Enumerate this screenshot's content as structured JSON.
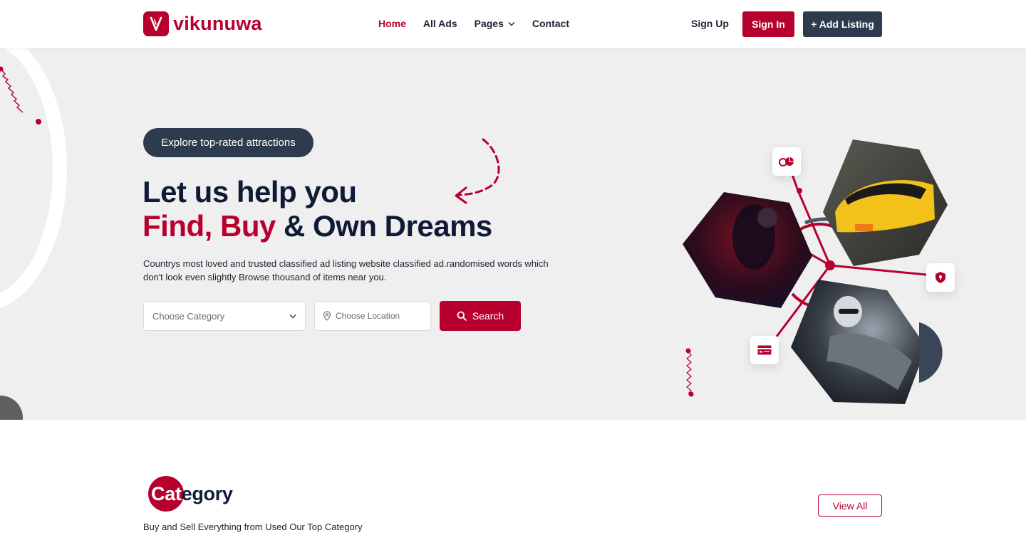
{
  "brand": {
    "name": "vikunuwa",
    "accent": "#b8002e",
    "dark": "#2e3b4e",
    "hero_bg": "#efefef"
  },
  "nav": {
    "items": [
      {
        "label": "Home",
        "active": true
      },
      {
        "label": "All Ads"
      },
      {
        "label": "Pages",
        "has_dropdown": true
      },
      {
        "label": "Contact"
      }
    ]
  },
  "auth": {
    "signup": "Sign Up",
    "signin": "Sign In",
    "add_listing": "+ Add Listing"
  },
  "hero": {
    "pill": "Explore top-rated attractions",
    "headline_1": "Let us help you",
    "headline_2a": "Find,",
    "headline_2b": "Buy",
    "headline_2c": "& Own Dreams",
    "description": "Countrys most loved and trusted classified ad listing website classified ad.randomised words which don't look even slightly Browse thousand of items near you.",
    "category_placeholder": "Choose Category",
    "location_placeholder": "Choose Location",
    "search_label": "Search"
  },
  "category": {
    "title_highlight": "Cat",
    "title_rest": "egory",
    "subtitle": "Buy and Sell Everything from Used Our Top Category",
    "view_all": "View All"
  }
}
